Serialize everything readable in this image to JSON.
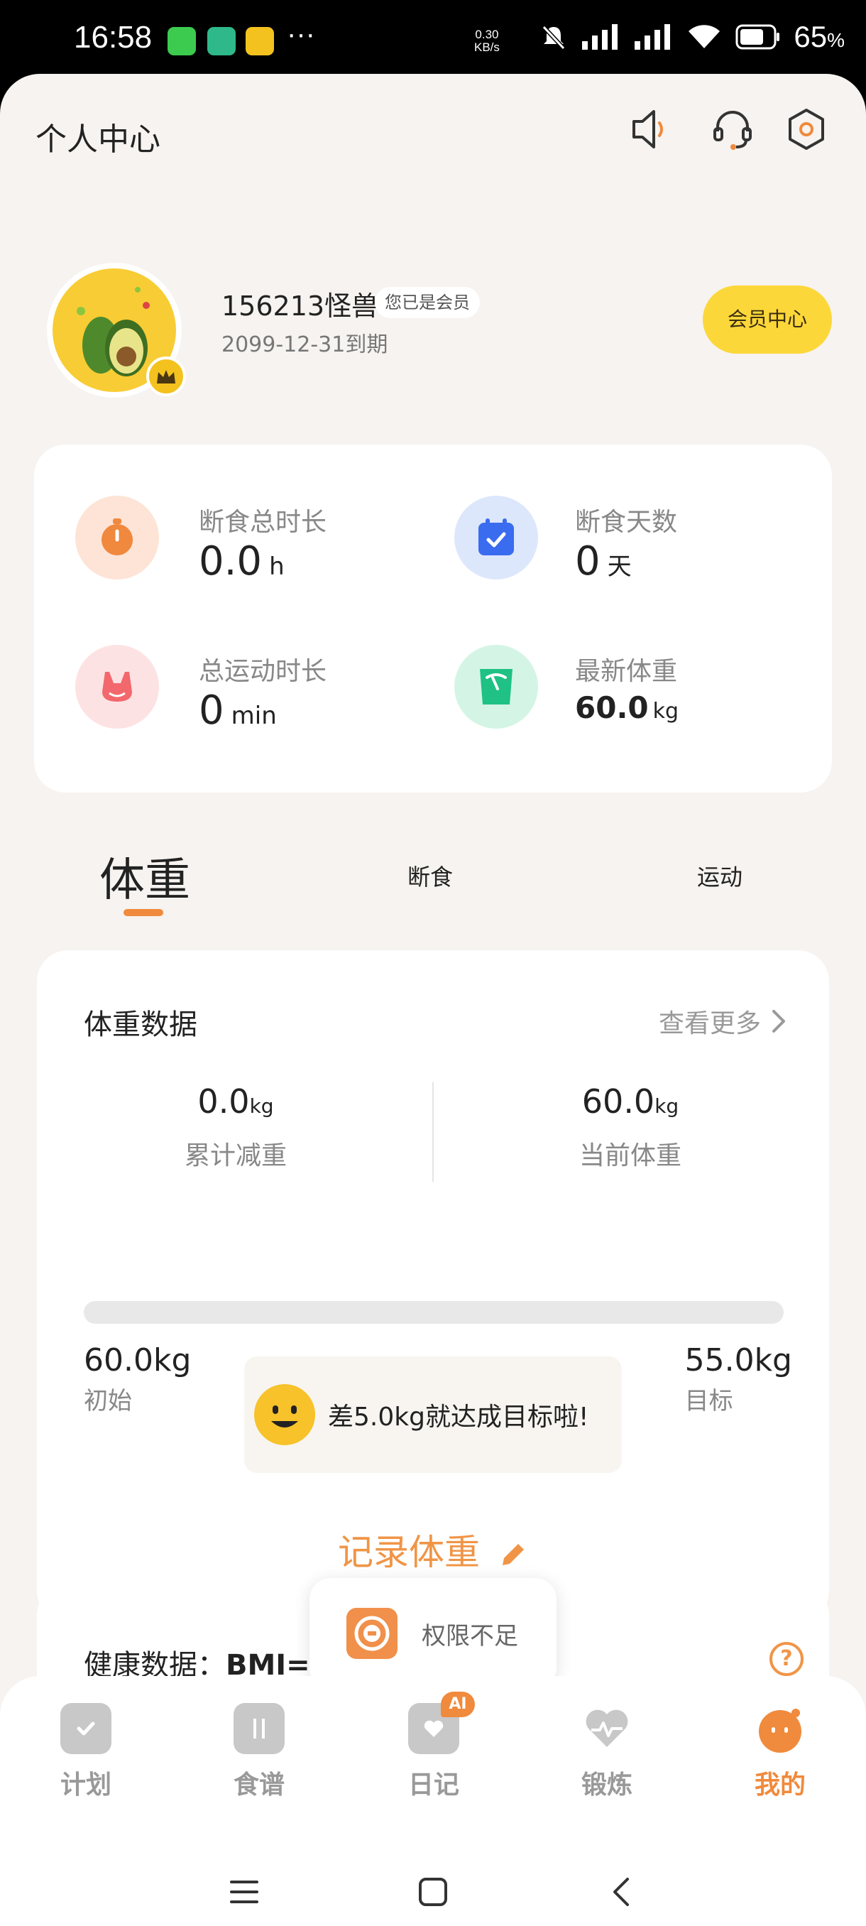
{
  "status_bar": {
    "time": "16:58",
    "app_icons": [
      "messages-icon",
      "green-app-icon",
      "yellow-app-icon"
    ],
    "more": "···",
    "net_speed_value": "0.30",
    "net_speed_unit": "KB/s",
    "battery": "65",
    "battery_unit": "%"
  },
  "header": {
    "title": "个人中心",
    "icons": [
      "announcement-icon",
      "customer-service-icon",
      "settings-icon"
    ]
  },
  "profile": {
    "username": "156213怪兽",
    "vip_badge": "您已是会员",
    "expire": "2099-12-31到期",
    "member_center_button": "会员中心"
  },
  "stats": {
    "fasting_total": {
      "label": "断食总时长",
      "value": "0.0",
      "unit": "h"
    },
    "fasting_days": {
      "label": "断食天数",
      "value": "0",
      "unit": "天"
    },
    "exercise_total": {
      "label": "总运动时长",
      "value": "0",
      "unit": "min"
    },
    "latest_weight": {
      "label": "最新体重",
      "value": "60.0",
      "unit": "kg"
    }
  },
  "tabs": [
    {
      "label": "体重",
      "active": true
    },
    {
      "label": "断食",
      "active": false
    },
    {
      "label": "运动",
      "active": false
    }
  ],
  "weight_card": {
    "title": "体重数据",
    "more": "查看更多",
    "lost": {
      "value": "0.0",
      "unit": "kg",
      "label": "累计减重"
    },
    "current": {
      "value": "60.0",
      "unit": "kg",
      "label": "当前体重"
    },
    "progress": 0,
    "start": {
      "value": "60.0kg",
      "label": "初始"
    },
    "goal": {
      "value": "55.0kg",
      "label": "目标"
    },
    "tip": "差5.0kg就达成目标啦!",
    "record_button": "记录体重"
  },
  "health_card": {
    "title_prefix": "健康数据：",
    "title_bold": "BMI=",
    "help": "?"
  },
  "toast": {
    "text": "权限不足"
  },
  "bottom_nav": [
    {
      "label": "计划",
      "active": false
    },
    {
      "label": "食谱",
      "active": false
    },
    {
      "label": "日记",
      "active": false,
      "badge": "AI"
    },
    {
      "label": "锻炼",
      "active": false
    },
    {
      "label": "我的",
      "active": true
    }
  ],
  "colors": {
    "accent": "#f08a3c",
    "member_yellow": "#fcd73a",
    "page_bg": "#f6f3f0"
  }
}
